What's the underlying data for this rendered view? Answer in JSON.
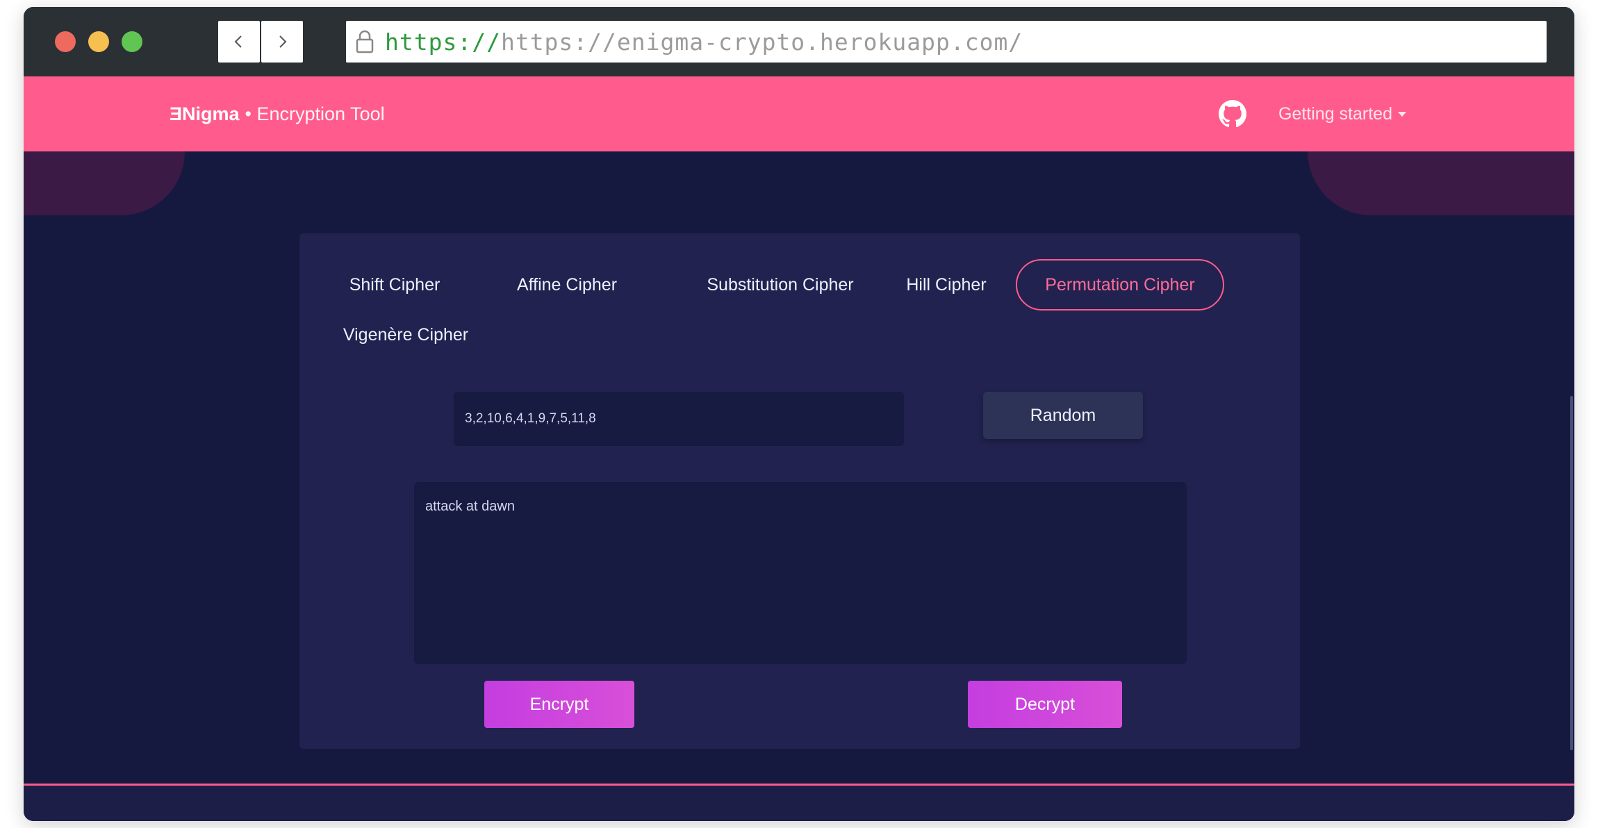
{
  "browser": {
    "url_scheme": "https://",
    "url_rest": "https://enigma-crypto.herokuapp.com/"
  },
  "navbar": {
    "brand_name": "ƎNigma",
    "brand_tagline": "• Encryption Tool",
    "getting_started": "Getting started"
  },
  "tabs": [
    {
      "label": "Shift Cipher"
    },
    {
      "label": "Affine Cipher"
    },
    {
      "label": "Substitution Cipher"
    },
    {
      "label": "Hill Cipher"
    },
    {
      "label": "Permutation Cipher",
      "active": true
    },
    {
      "label": "Vigenère Cipher"
    }
  ],
  "form": {
    "key_value": "3,2,10,6,4,1,9,7,5,11,8",
    "random_label": "Random",
    "message_value": "attack at dawn",
    "encrypt_label": "Encrypt",
    "decrypt_label": "Decrypt"
  },
  "colors": {
    "accent": "#ff5c8d",
    "background": "#16193f",
    "card": "#21224f",
    "button_gradient": "#c43ee0"
  },
  "icons": {
    "back": "chevron-left-icon",
    "forward": "chevron-right-icon",
    "lock": "lock-icon",
    "github": "github-icon",
    "dropdown": "caret-down-icon"
  }
}
